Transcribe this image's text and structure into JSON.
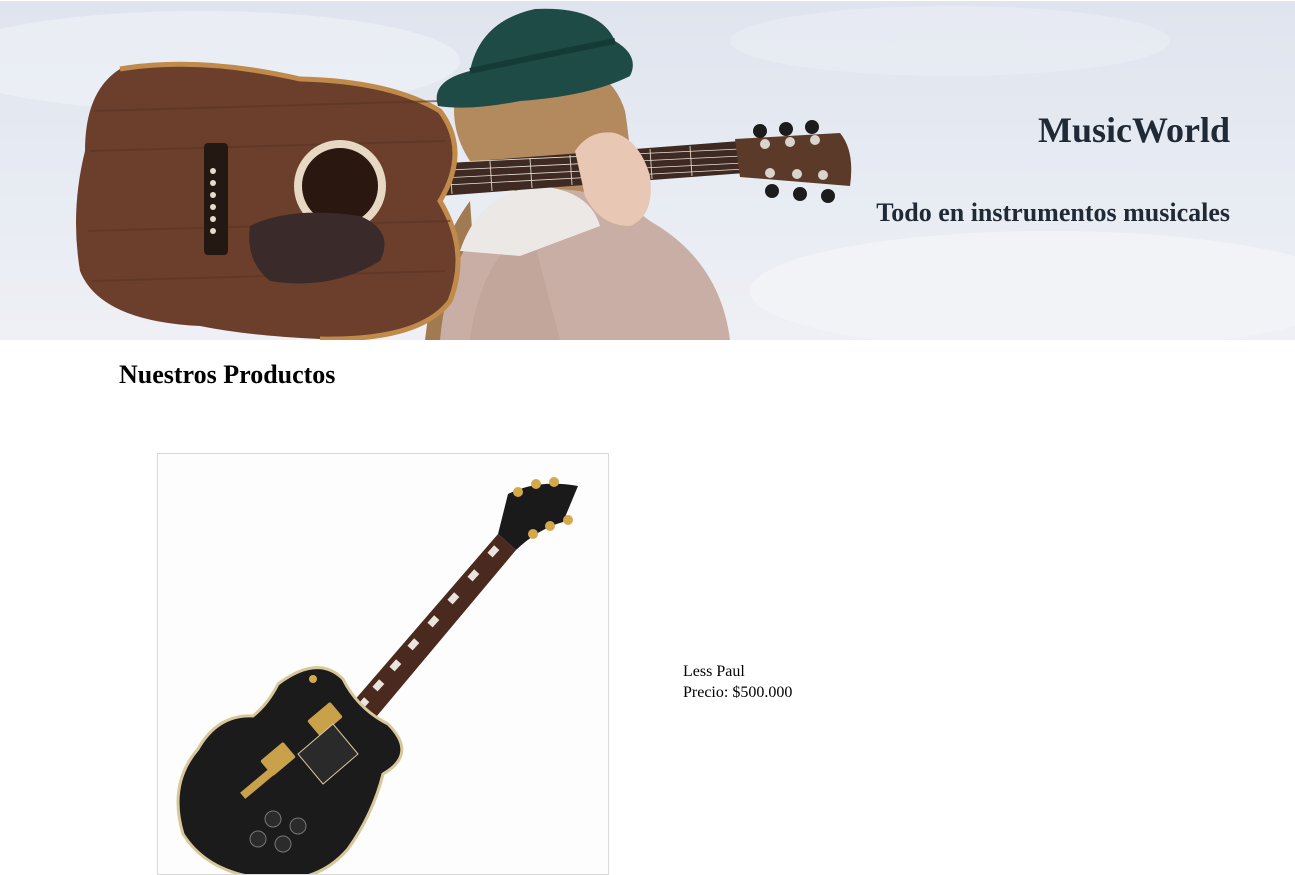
{
  "header": {
    "title": "MusicWorld",
    "subtitle": "Todo en instrumentos musicales",
    "hero_image": "woman-with-acoustic-guitar-photo"
  },
  "main": {
    "section_title": "Nuestros Productos",
    "products": [
      {
        "name": "Less Paul",
        "price_label": "Precio:",
        "price": "$500.000",
        "image": "black-electric-guitar-photo"
      }
    ]
  },
  "colors": {
    "heading_text": "#1f2a36",
    "guitar_wood": "#6b3f2c",
    "hat": "#1e4b46",
    "sweater": "#c9aea5"
  }
}
